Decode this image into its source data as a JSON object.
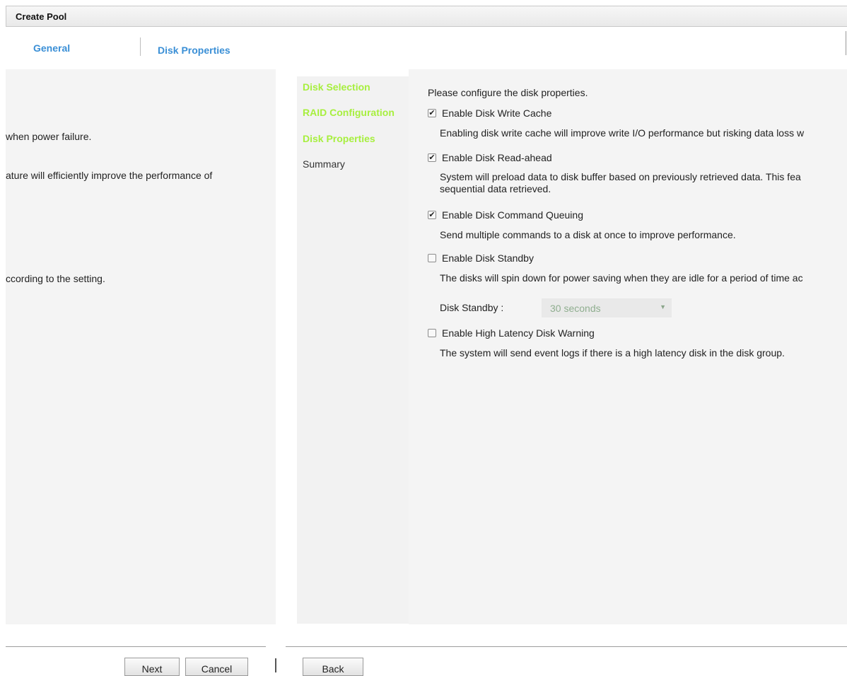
{
  "dialog": {
    "title": "Create Pool"
  },
  "tabs": [
    {
      "label": "General"
    },
    {
      "label": "Disk Properties"
    }
  ],
  "left_panel": {
    "fragments": [
      "when power failure.",
      "ature will efficiently improve the performance of",
      "ccording to the setting."
    ]
  },
  "steps": [
    {
      "label": "Disk Selection",
      "state": "done"
    },
    {
      "label": "RAID Configuration",
      "state": "done"
    },
    {
      "label": "Disk Properties",
      "state": "done"
    },
    {
      "label": "Summary",
      "state": "pending"
    }
  ],
  "form": {
    "intro": "Please configure the disk properties.",
    "options": [
      {
        "label": "Enable Disk Write Cache",
        "checked": true,
        "desc": [
          "Enabling disk write cache will improve write I/O performance but risking data loss w"
        ]
      },
      {
        "label": "Enable Disk Read-ahead",
        "checked": true,
        "desc": [
          "System will preload data to disk buffer based on previously retrieved data. This fea",
          "sequential data retrieved."
        ]
      },
      {
        "label": "Enable Disk Command Queuing",
        "checked": true,
        "desc": [
          "Send multiple commands to a disk at once to improve performance."
        ]
      },
      {
        "label": "Enable Disk Standby",
        "checked": false,
        "desc": [
          "The disks will spin down for power saving when they are idle for a period of time ac"
        ]
      },
      {
        "label": "Enable High Latency Disk Warning",
        "checked": false,
        "desc": [
          "The system will send event logs if there is a high latency disk in the disk group."
        ]
      }
    ],
    "standby": {
      "label": "Disk Standby :",
      "value": "30 seconds"
    }
  },
  "footer": {
    "next_label": "Next",
    "cancel_label": "Cancel",
    "back_label": "Back"
  },
  "colors": {
    "tab_text": "#3a8fd6",
    "step_done": "#a7ef3e",
    "disabled_select_text": "#8fae8f"
  },
  "icons": {
    "checkbox_checked": "check-icon",
    "select_arrow": "triangle-down-icon"
  }
}
